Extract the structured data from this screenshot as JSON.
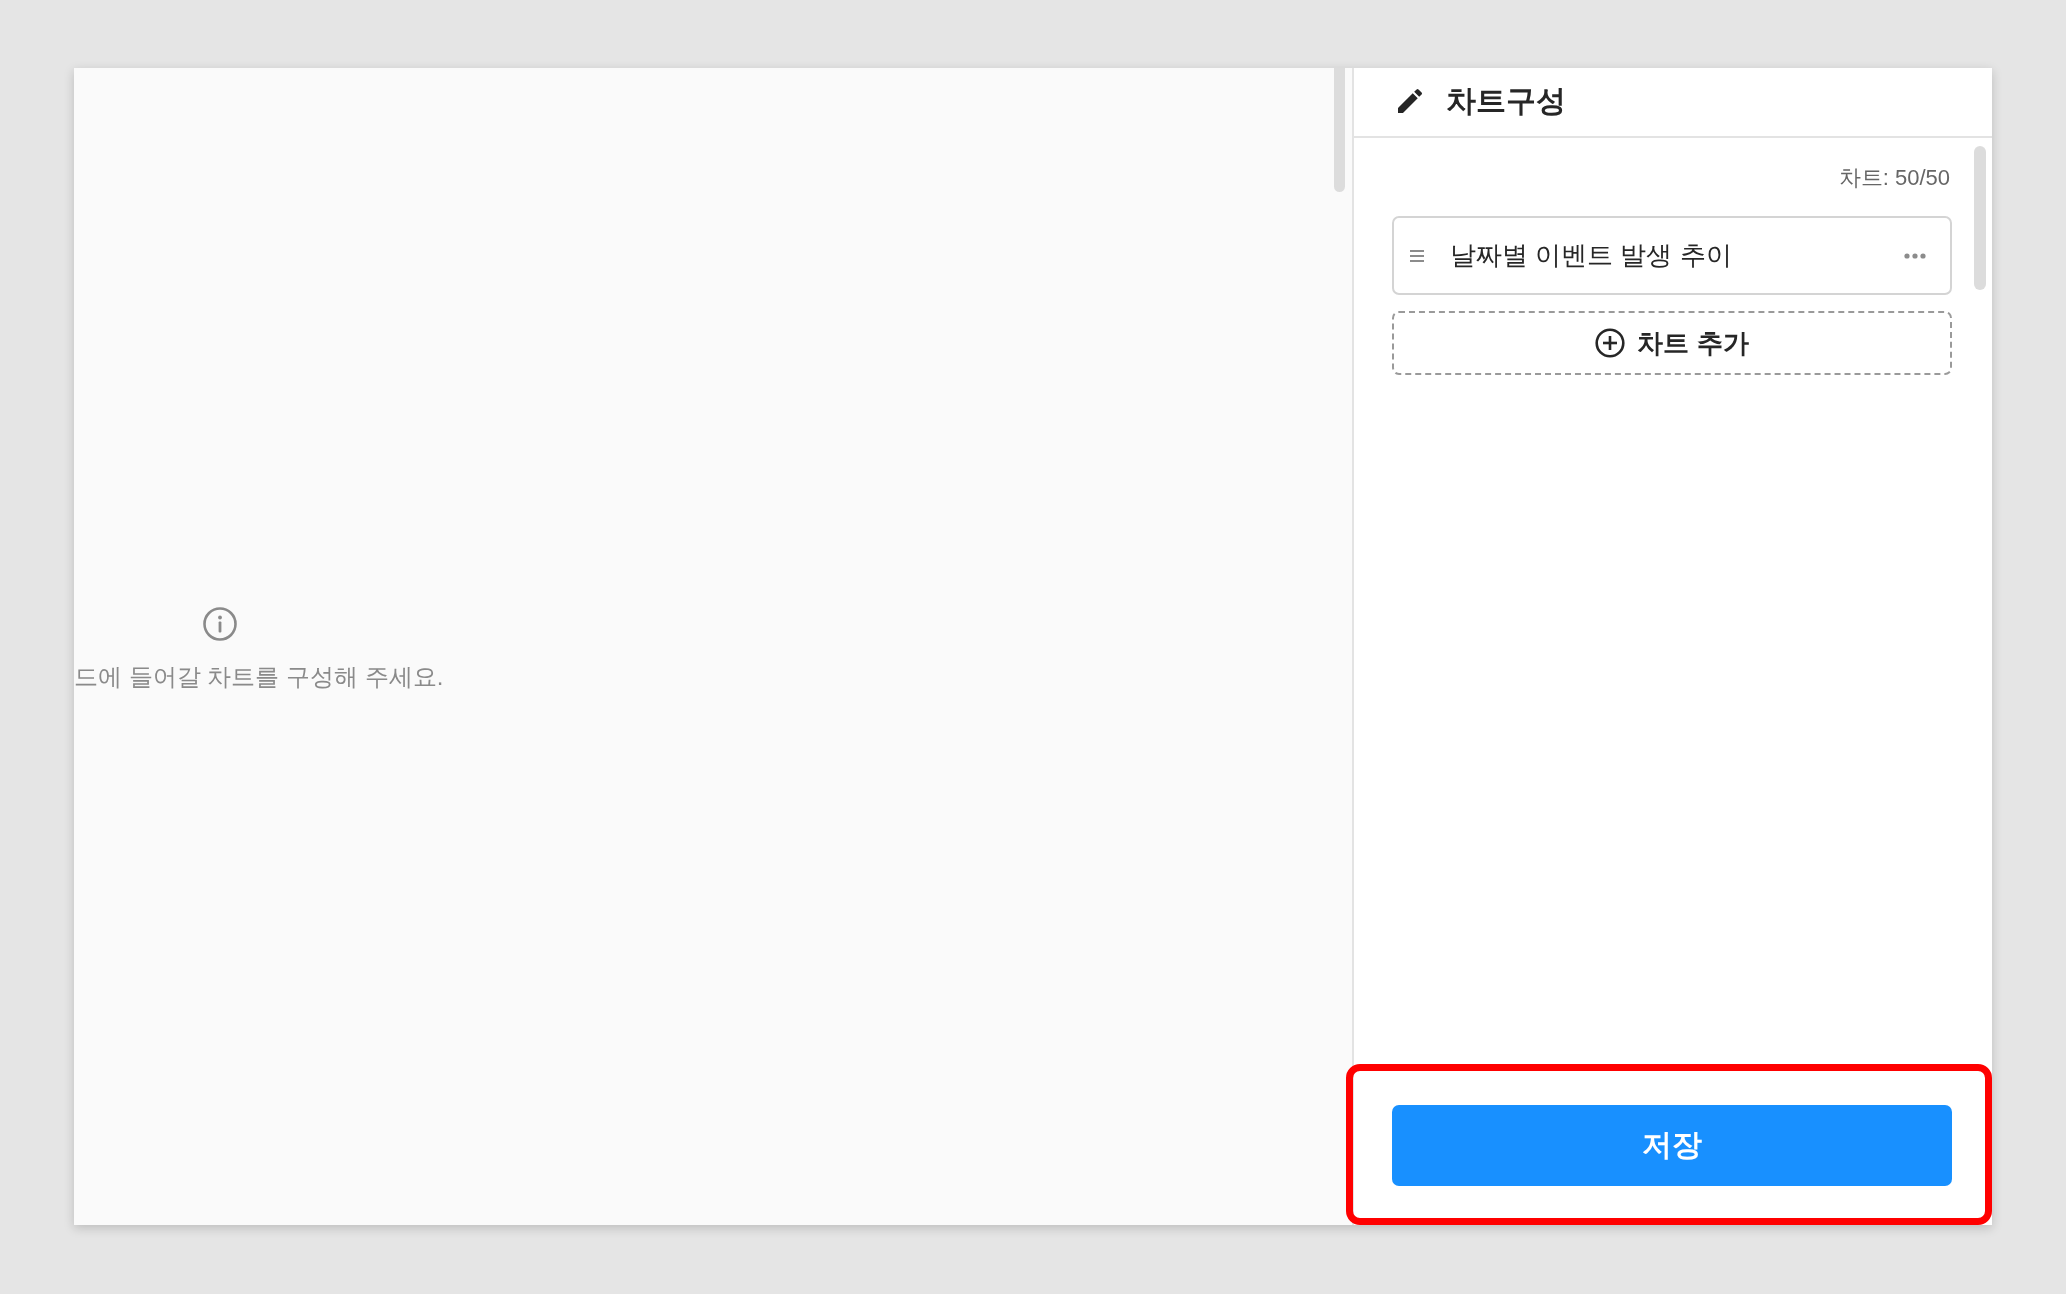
{
  "empty_state": {
    "message": "드에 들어갈 차트를 구성해 주세요."
  },
  "panel": {
    "title": "차트구성",
    "count": "차트: 50/50",
    "charts": [
      {
        "title": "날짜별 이벤트 발생 추이"
      }
    ],
    "add_button": "차트 추가"
  },
  "footer": {
    "save_button": "저장",
    "highlighted": true
  }
}
